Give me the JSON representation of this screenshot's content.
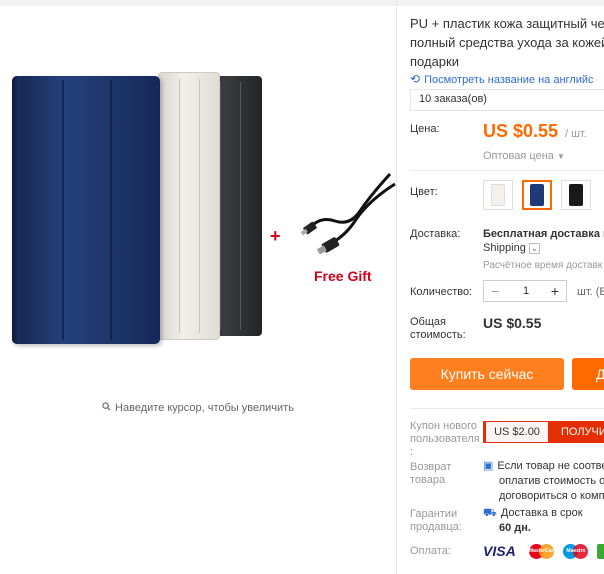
{
  "gallery": {
    "free_gift": "Free Gift",
    "plus": "+",
    "zoom_hint": "Наведите курсор, чтобы увеличить"
  },
  "product": {
    "title_lines": [
      "PU + пластик кожа защитный че",
      "полный средства ухода за кожей",
      "подарки"
    ],
    "translate_link": "Посмотреть название на английс",
    "orders": "10 заказа(ов)"
  },
  "price": {
    "label": "Цена:",
    "value": "US $0.55",
    "unit": "/ шт.",
    "wholesale": "Оптовая цена"
  },
  "color": {
    "label": "Цвет:",
    "options": [
      "white",
      "blue",
      "black"
    ],
    "selected": "blue"
  },
  "shipping": {
    "label": "Доставка:",
    "line1": "Бесплатная доставка в",
    "line2": "Shipping",
    "line3": "Расчётное время доставк"
  },
  "quantity": {
    "label": "Количество:",
    "value": "1",
    "unit": "шт. (Е"
  },
  "total": {
    "label_line1": "Общая",
    "label_line2": "стоимость:",
    "value": "US $0.55"
  },
  "actions": {
    "buy_now": "Купить сейчас",
    "add_to_cart": "Д"
  },
  "coupon": {
    "label_lines": [
      "Купон нового",
      "пользователя",
      ":"
    ],
    "amount": "US $2.00",
    "get": "ПОЛУЧИ"
  },
  "returns": {
    "label_lines": [
      "Возврат",
      "товара"
    ],
    "text_lines": [
      "Если товар не соотве",
      "оплатив стоимость о",
      "договориться о комп"
    ]
  },
  "guarantee": {
    "label_lines": [
      "Гарантии",
      "продавца:"
    ],
    "text_line1": "Доставка в срок",
    "text_line2": "60 дн."
  },
  "payment": {
    "label": "Оплата:",
    "visa": "VISA",
    "mastercard": "MasterCard",
    "maestro": "Maestro"
  },
  "colors": {
    "accent": "#ff6a00",
    "buy_button": "#ff7f1f",
    "link": "#2f6dce",
    "coupon_red": "#e62e04",
    "gift_red": "#d0021b"
  }
}
